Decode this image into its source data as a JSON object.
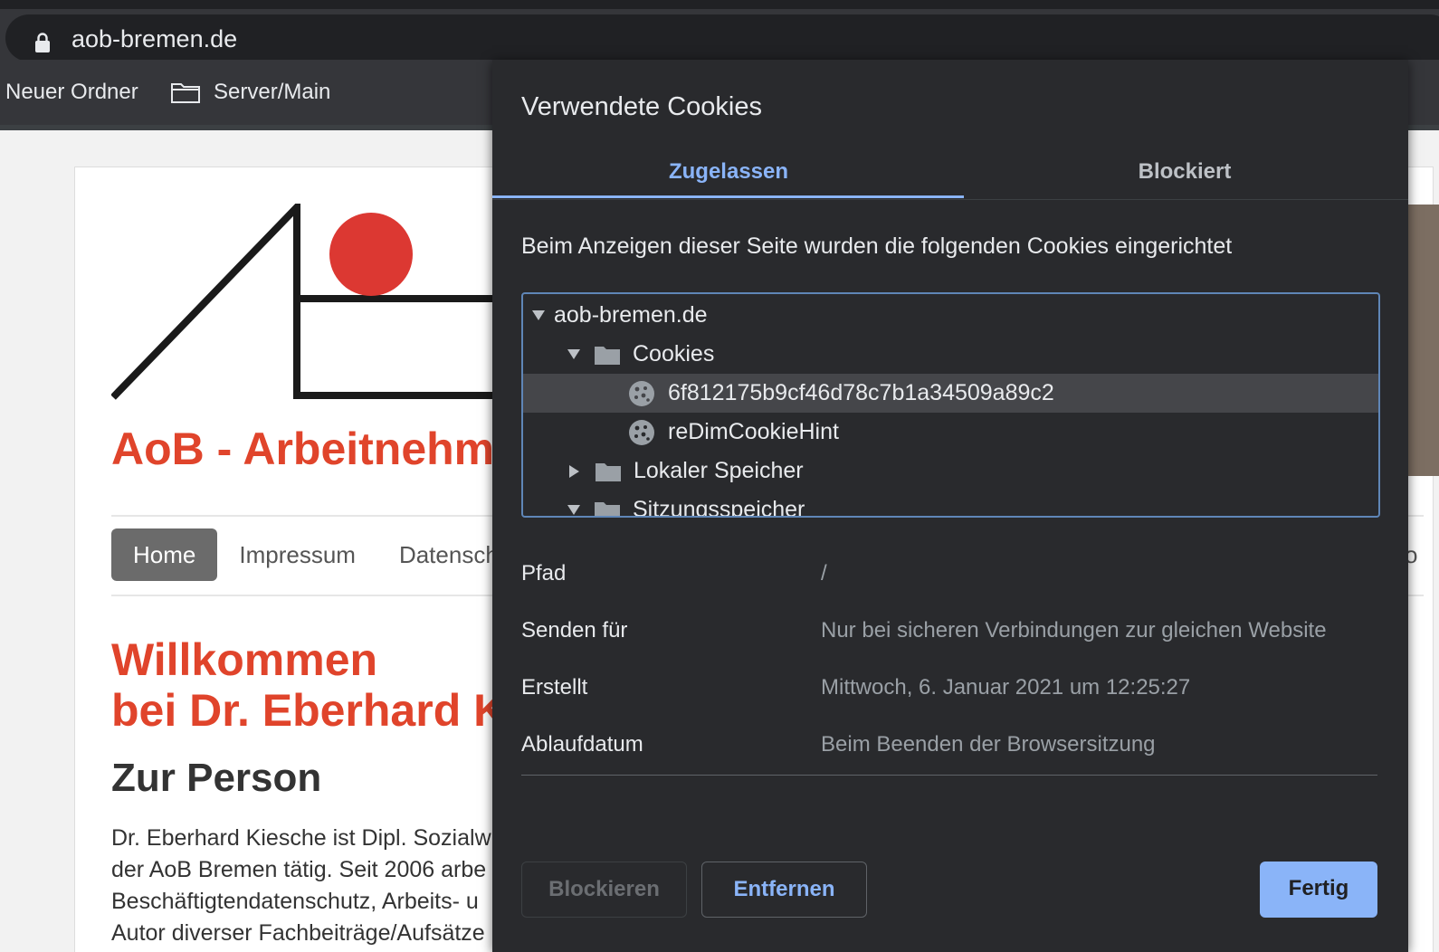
{
  "browser": {
    "url": "aob-bremen.de",
    "bookmarks": [
      {
        "label": "Neuer Ordner"
      },
      {
        "label": "Server/Main"
      }
    ]
  },
  "page": {
    "site_title": "AoB - Arbeitnehm",
    "nav": [
      "Home",
      "Impressum",
      "Datensch"
    ],
    "welcome_line1": "Willkommen",
    "welcome_line2": "bei Dr. Eberhard K",
    "section_title": "Zur Person",
    "paragraph": [
      "Dr. Eberhard Kiesche ist Dipl. Sozialw",
      "der AoB Bremen tätig. Seit 2006 arbe",
      "Beschäftigtendatenschutz, Arbeits- u",
      "Autor diverser Fachbeiträge/Aufsätze"
    ],
    "right_fragment": "o",
    "brand_color": "#e0442b"
  },
  "dialog": {
    "title": "Verwendete Cookies",
    "tabs": [
      {
        "label": "Zugelassen",
        "active": true
      },
      {
        "label": "Blockiert",
        "active": false
      }
    ],
    "description": "Beim Anzeigen dieser Seite wurden die folgenden Cookies eingerichtet",
    "tree": {
      "domain": "aob-bremen.de",
      "cookies_folder": "Cookies",
      "cookie1": "6f812175b9cf46d78c7b1a34509a89c2",
      "cookie2": "reDimCookieHint",
      "local_storage": "Lokaler Speicher",
      "session_storage": "Sitzungsspeicher"
    },
    "details": {
      "path_label": "Pfad",
      "path_value": "/",
      "send_label": "Senden für",
      "send_value": "Nur bei sicheren Verbindungen zur gleichen Website",
      "created_label": "Erstellt",
      "created_value": "Mittwoch, 6. Januar 2021 um 12:25:27",
      "expires_label": "Ablaufdatum",
      "expires_value": "Beim Beenden der Browsersitzung"
    },
    "buttons": {
      "block": "Blockieren",
      "remove": "Entfernen",
      "done": "Fertig"
    },
    "accent_color": "#8ab4f8"
  }
}
